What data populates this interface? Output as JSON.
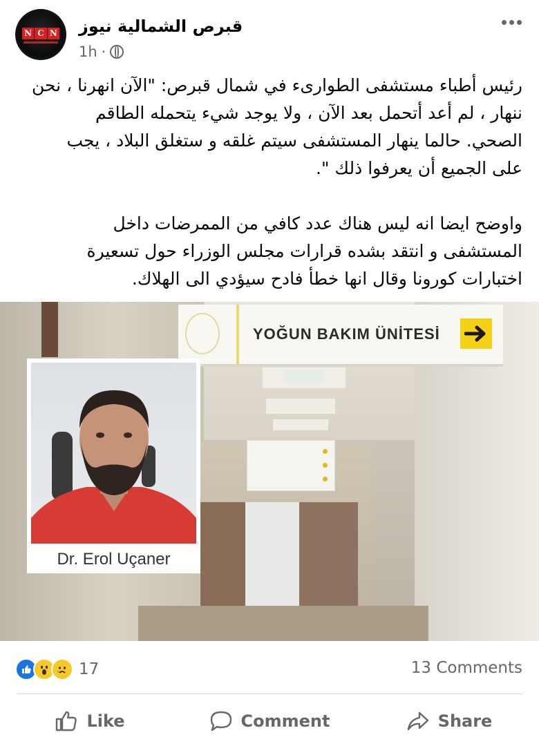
{
  "header": {
    "page_name": "قبرص الشمالية نيوز",
    "time": "1h",
    "privacy_dot": "·",
    "avatar_logo": [
      "N",
      "C",
      "N"
    ]
  },
  "post": {
    "paragraphs": [
      "رئيس أطباء مستشفى الطوارىء في شمال قبرص: \"الآن انهرنا ، نحن\nننهار ، لم أعد أتحمل بعد الآن ، ولا يوجد شيء يتحمله الطاقم\nالصحي.  حالما ينهار المستشفى سيتم غلقه و ستغلق البلاد ، يجب\nعلى الجميع أن يعرفوا ذلك \".",
      "واوضح ايضا انه ليس هناك عدد كافي من الممرضات داخل\nالمستشفى و انتقد بشده قرارات مجلس الوزراء حول تسعيرة\nاختبارات كورونا وقال انها خطأ فادح سيؤدي الى الهلاك."
    ]
  },
  "image": {
    "sign_text": "YOĞUN BAKIM ÜNİTESİ",
    "inset_caption": "Dr. Erol Uçaner"
  },
  "stats": {
    "reaction_count": "17",
    "comments": "13 Comments",
    "reactions": [
      "like",
      "wow",
      "sad"
    ]
  },
  "actions": {
    "like": "Like",
    "comment": "Comment",
    "share": "Share"
  },
  "colors": {
    "accent": "#1b74e4",
    "secondary_text": "#65676b",
    "logo_red": "#d8201f",
    "sign_yellow": "#f3d116"
  }
}
